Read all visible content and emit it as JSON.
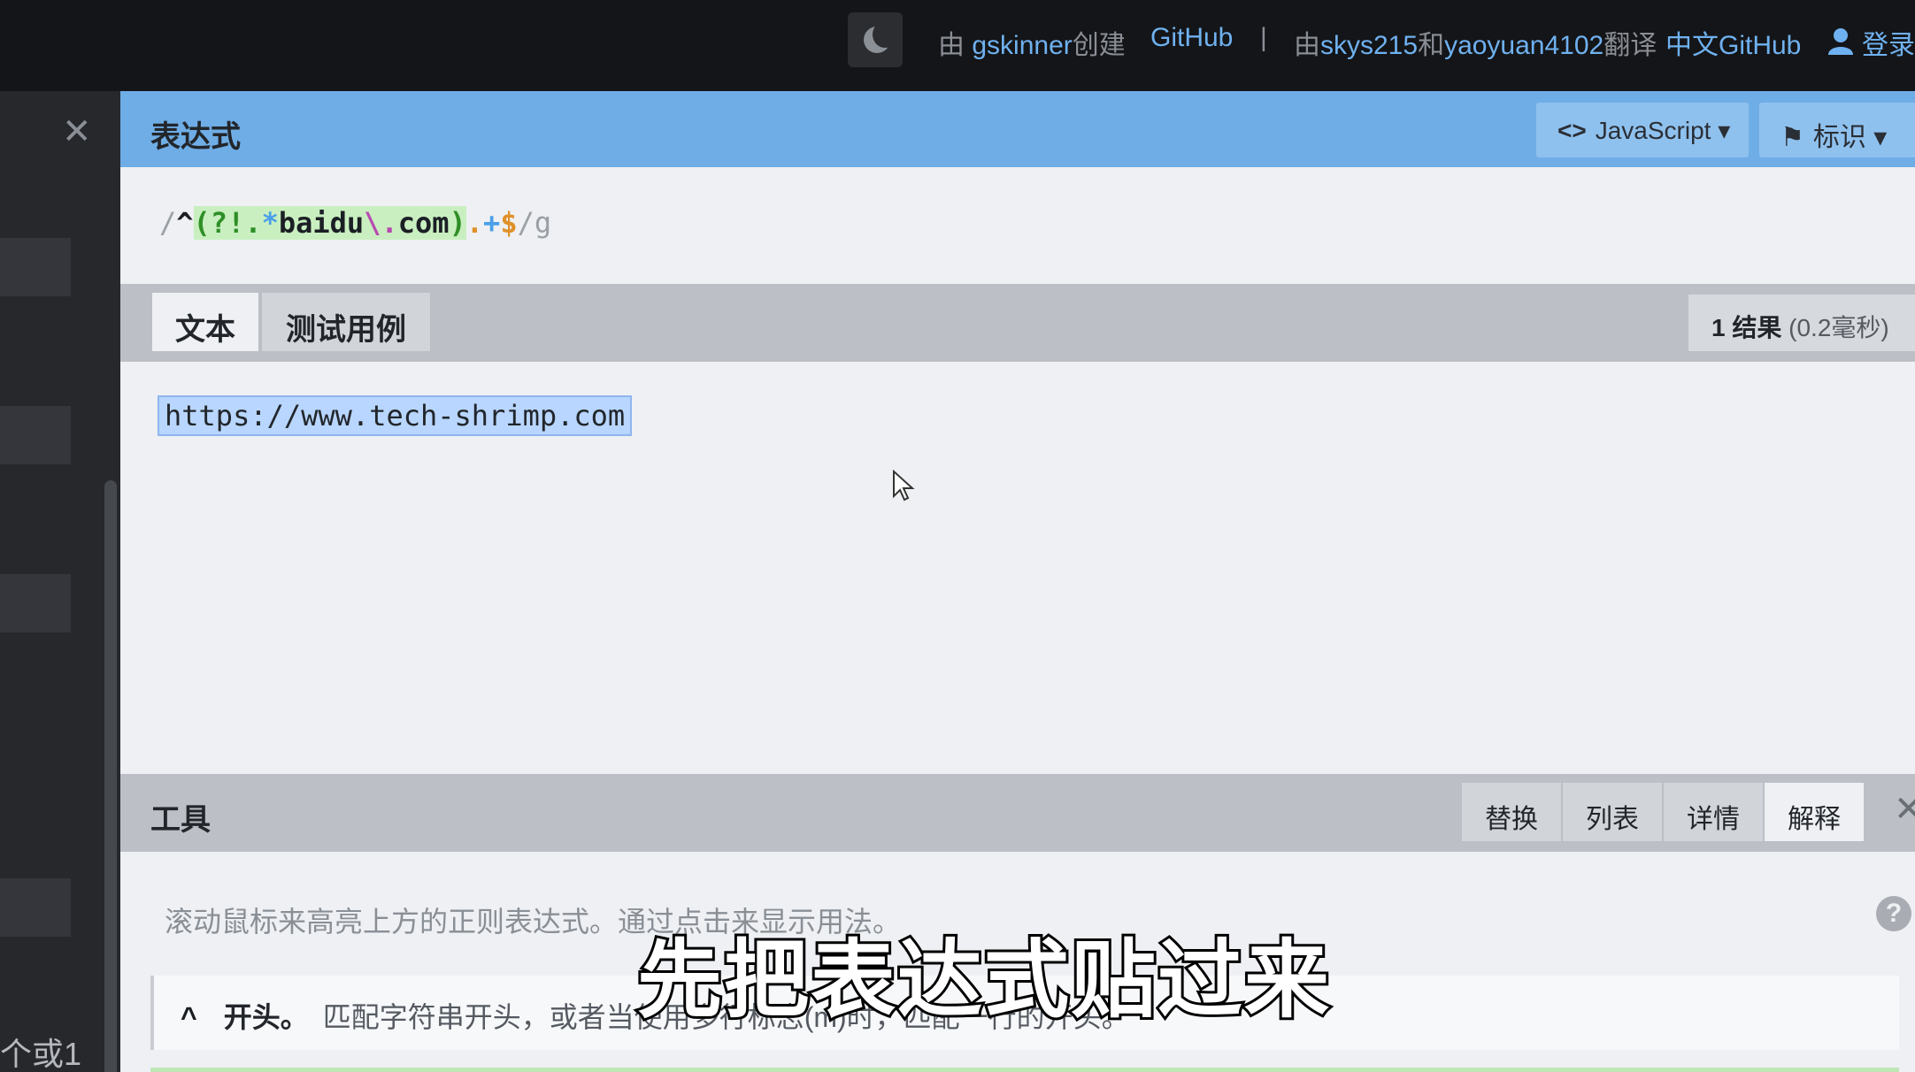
{
  "topbar": {
    "theme_icon": "moon-icon",
    "credit_prefix": "由 ",
    "credit_author": "gskinner",
    "credit_suffix": "创建",
    "github": "GitHub",
    "separator": "|",
    "trans_prefix": "由",
    "trans_user1": "skys215",
    "trans_and": "和",
    "trans_user2": "yaoyuan4102",
    "trans_suffix": "翻译",
    "cn_github": "中文GitHub",
    "login": "登录",
    "user_icon": "user-icon"
  },
  "sidebar": {
    "close": "✕",
    "partial_text": "个或1"
  },
  "expression": {
    "title": "表达式",
    "flavor_label": "JavaScript ▾",
    "flags_label": "标识 ▾",
    "regex_parts": {
      "open": "/",
      "anchor": "^",
      "group": "(?!.*baidu\\.com)",
      "g_open": "(?!",
      "g_dot": ".",
      "g_star": "*",
      "g_lit1": "baidu",
      "g_esc": "\\.",
      "g_lit2": "com",
      "g_close": ")",
      "dot": ".",
      "plus": "+",
      "end": "$",
      "close": "/",
      "flag": "g"
    }
  },
  "text_panel": {
    "tab_text": "文本",
    "tab_tests": "测试用例",
    "result_count": "1 结果",
    "result_time": "(0.2毫秒)",
    "sample": "https://www.tech-shrimp.com"
  },
  "tools": {
    "title": "工具",
    "tabs": [
      "替换",
      "列表",
      "详情",
      "解释"
    ],
    "close": "✕",
    "hint": "滚动鼠标来高亮上方的正则表达式。通过点击来显示用法。",
    "help": "?",
    "explain_token": "^",
    "explain_term": "开头。",
    "explain_desc": "匹配字符串开头，或者当使用多行标志(m)时，匹配一行的开头。"
  },
  "subtitle": "先把表达式贴过来"
}
